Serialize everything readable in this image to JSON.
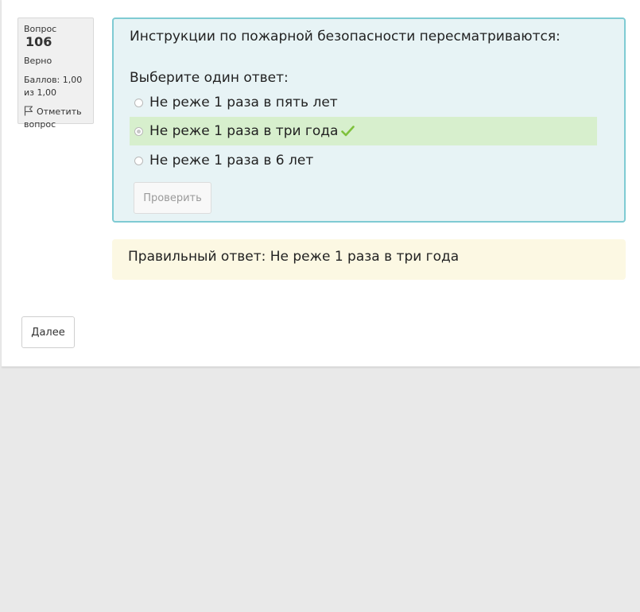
{
  "question_info": {
    "number_label": "Вопрос",
    "number": "106",
    "state": "Верно",
    "grade": "Баллов: 1,00 из 1,00",
    "flag_label": "Отметить вопрос"
  },
  "question": {
    "text": "Инструкции по пожарной безопасности пересматриваются:",
    "prompt": "Выберите один ответ:",
    "options": [
      {
        "label": "Не реже 1 раза в пять лет",
        "selected": false,
        "correct": false
      },
      {
        "label": "Не реже 1 раза в три года",
        "selected": true,
        "correct": true
      },
      {
        "label": "Не реже 1 раза в 6 лет",
        "selected": false,
        "correct": false
      }
    ],
    "check_button": "Проверить"
  },
  "feedback": {
    "right_answer": "Правильный ответ: Не реже 1 раза в три года"
  },
  "navigation": {
    "next_button": "Далее"
  },
  "colors": {
    "formulation_bg": "#e7f3f5",
    "formulation_border": "#7fcbd3",
    "correct_bg": "#d7efcd",
    "check_icon": "#7ec13b",
    "feedback_bg": "#fcf8e3",
    "page_bg": "#e9e9e9"
  }
}
